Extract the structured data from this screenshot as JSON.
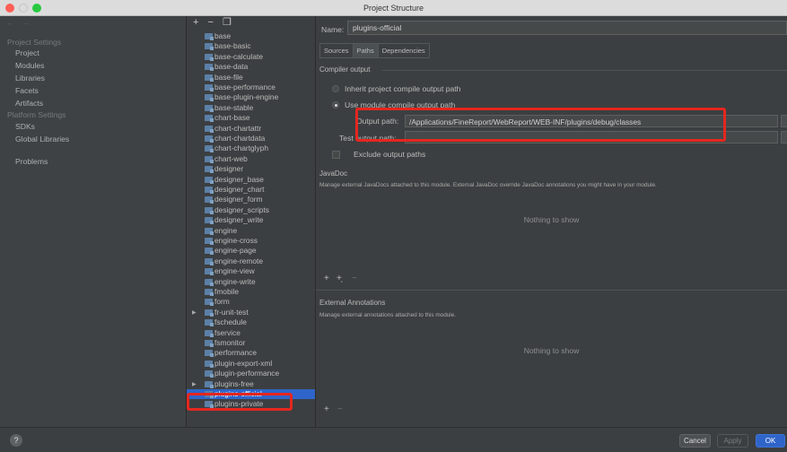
{
  "window": {
    "title": "Project Structure"
  },
  "sidebar": {
    "nav_arrows": "← →",
    "project_settings_header": "Project Settings",
    "project_items": [
      "Project",
      "Modules",
      "Libraries",
      "Facets",
      "Artifacts"
    ],
    "platform_settings_header": "Platform Settings",
    "platform_items": [
      "SDKs",
      "Global Libraries"
    ],
    "problems": "Problems"
  },
  "module_toolbar": {
    "add": "+",
    "remove": "−",
    "copy": "❐"
  },
  "modules": [
    "base",
    "base-basic",
    "base-calculate",
    "base-data",
    "base-file",
    "base-performance",
    "base-plugin-engine",
    "base-stable",
    "chart-base",
    "chart-chartattr",
    "chart-chartdata",
    "chart-chartglyph",
    "chart-web",
    "designer",
    "designer_base",
    "designer_chart",
    "designer_form",
    "designer_scripts",
    "designer_write",
    "engine",
    "engine-cross",
    "engine-page",
    "engine-remote",
    "engine-view",
    "engine-write",
    "fmobile",
    "form",
    "fr-unit-test",
    "fschedule",
    "fservice",
    "fsmonitor",
    "performance",
    "plugin-export-xml",
    "plugin-performance",
    "plugins-free",
    "plugins-official",
    "plugins-private"
  ],
  "selected_module": "plugins-official",
  "detail": {
    "name_label": "Name:",
    "name_value": "plugins-official",
    "tabs": [
      "Sources",
      "Paths",
      "Dependencies"
    ],
    "active_tab": "Paths",
    "compiler_output_title": "Compiler output",
    "inherit_label": "Inherit project compile output path",
    "use_module_label": "Use module compile output path",
    "output_path_label": "Output path:",
    "output_path_value": "/Applications/FineReport/WebReport/WEB-INF/plugins/debug/classes",
    "test_output_path_label": "Test output path:",
    "test_output_path_value": "",
    "exclude_label": "Exclude output paths",
    "javadoc_title": "JavaDoc",
    "javadoc_desc": "Manage external JavaDocs attached to this module. External JavaDoc override JavaDoc annotations you might have in your module.",
    "javadoc_empty": "Nothing to show",
    "javadoc_add": "+",
    "javadoc_add_url": "+̩",
    "javadoc_remove": "−",
    "ext_annotations_title": "External Annotations",
    "ext_annotations_desc": "Manage external annotations attached to this module.",
    "ext_annotations_empty": "Nothing to show",
    "ext_add": "+",
    "ext_remove": "−"
  },
  "footer": {
    "help": "?",
    "cancel": "Cancel",
    "apply": "Apply",
    "ok": "OK"
  },
  "highlight_color": "#e5261f",
  "selection_color": "#2f65ca"
}
